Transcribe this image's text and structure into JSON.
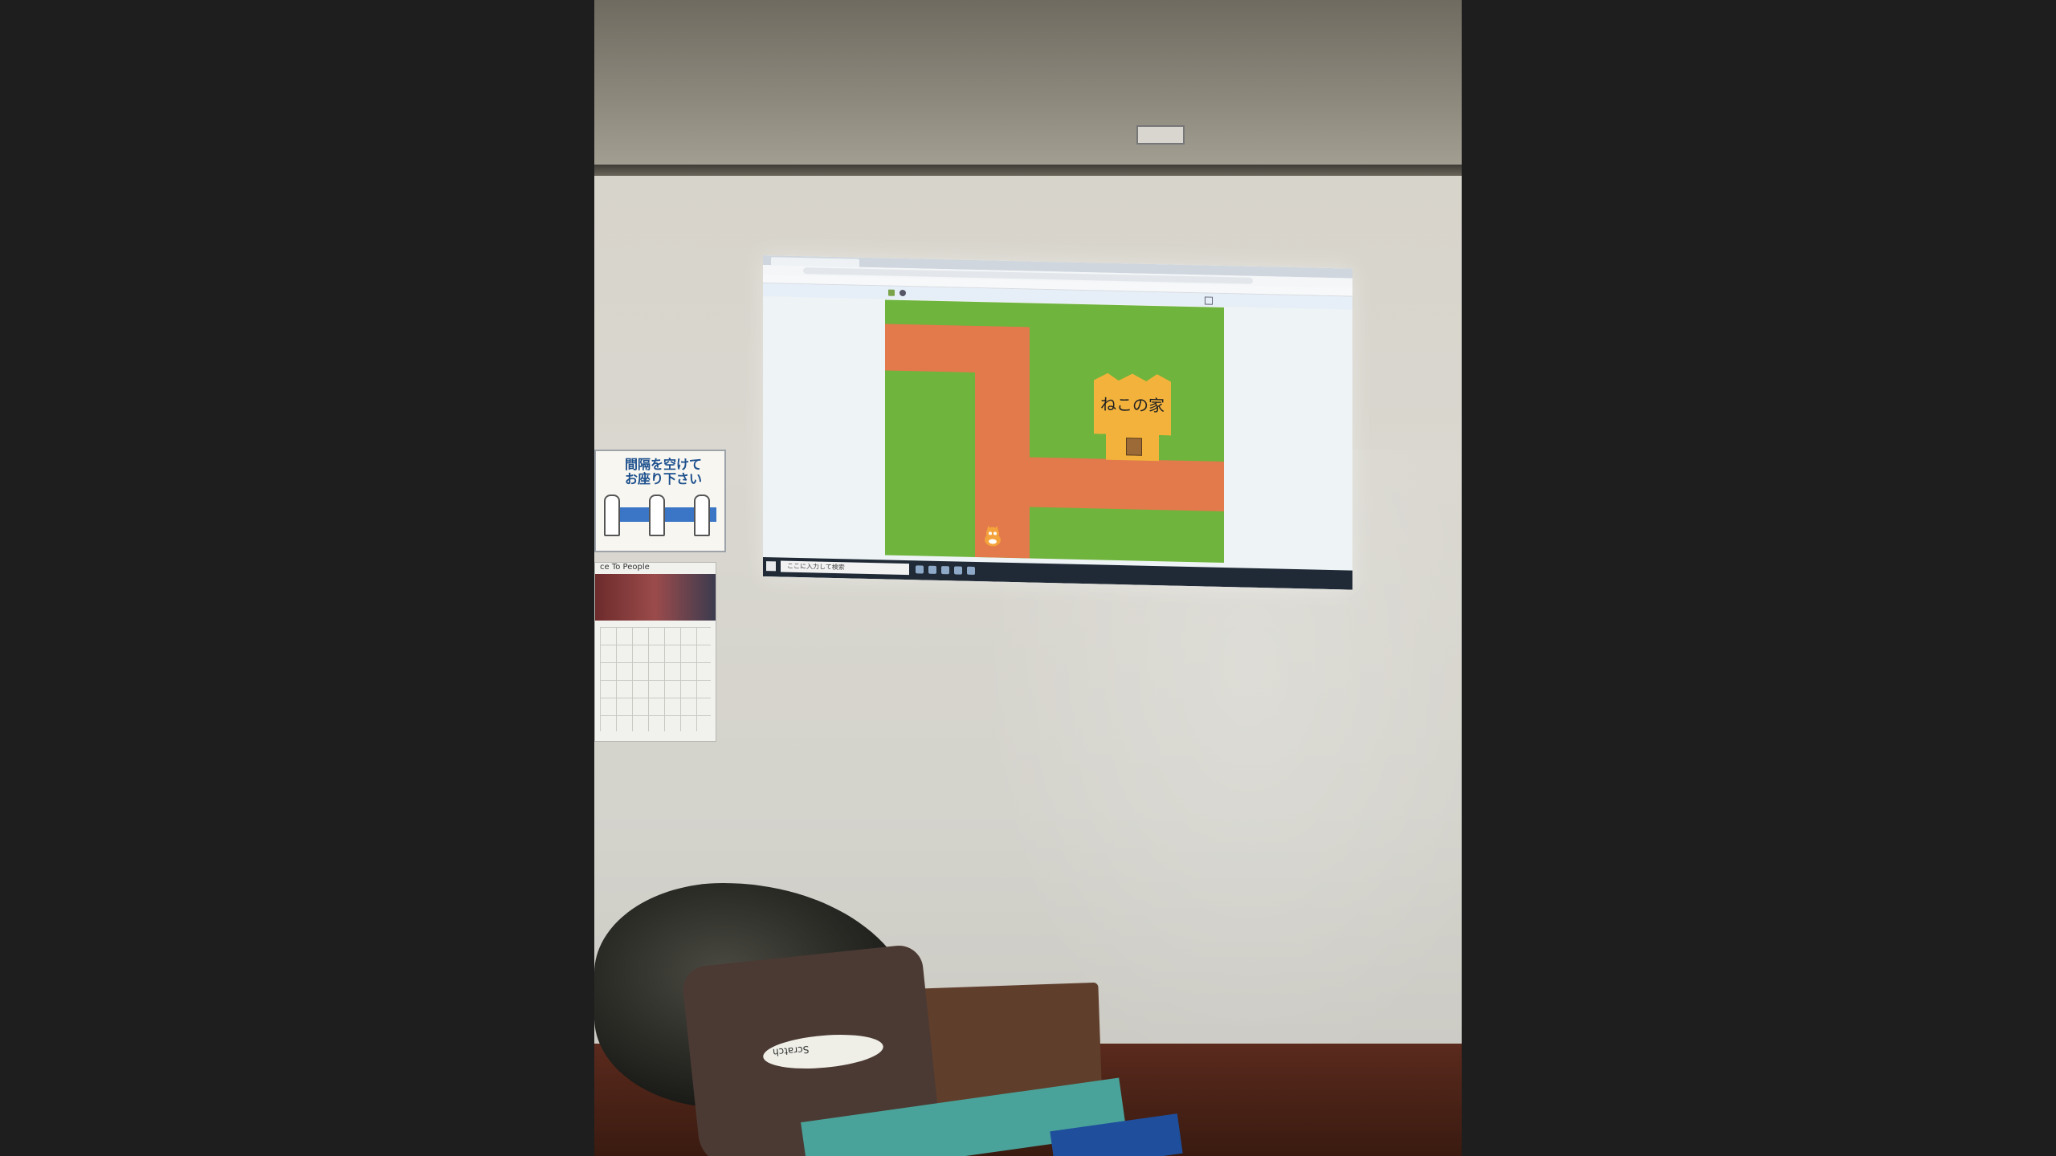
{
  "scene": {
    "description_kind": "photo of projected Scratch game on a classroom wall"
  },
  "projection": {
    "game_label": "ねこの家",
    "taskbar_search_text": "ここに入力して検索"
  },
  "poster": {
    "text_line1": "間隔を空けて",
    "text_line2": "お座り下さい"
  },
  "calendar": {
    "header": "ce To People"
  },
  "tote_bag": {
    "text": "Scratch"
  },
  "colors": {
    "grass": "#6fb43c",
    "path": "#e27a4c",
    "house": "#f3b23c"
  },
  "icons": [
    "flag-icon",
    "stop-icon",
    "fullscreen-icon",
    "cat-sprite-icon",
    "start-icon"
  ]
}
